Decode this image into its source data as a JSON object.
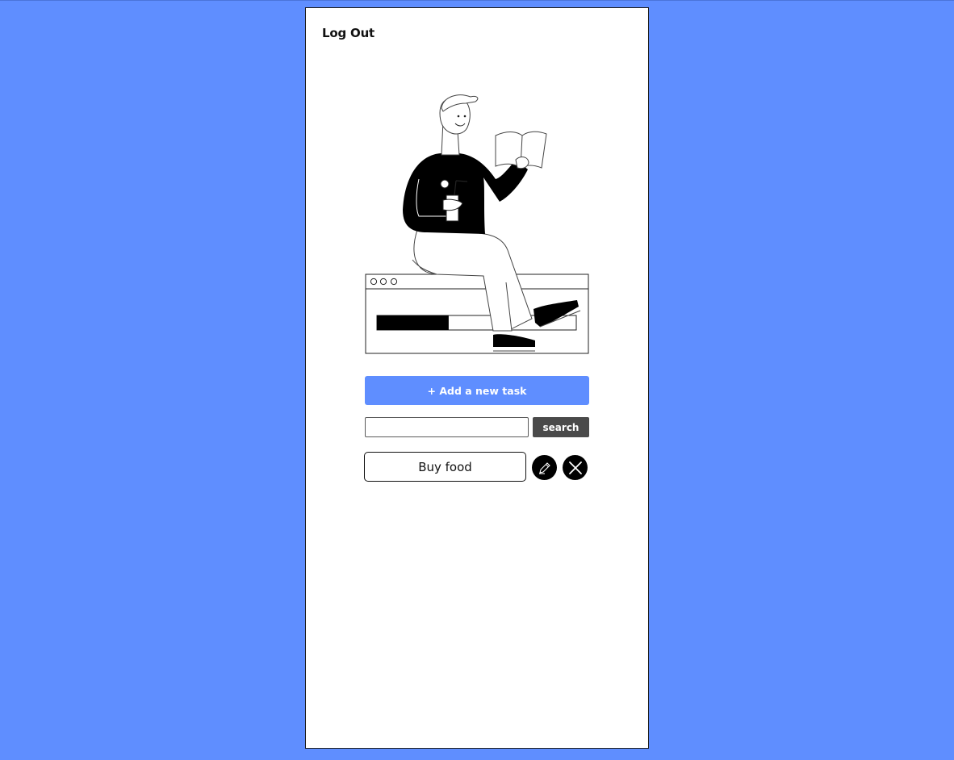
{
  "header": {
    "logout_label": "Log Out"
  },
  "actions": {
    "add_task_label": "+ Add a new task"
  },
  "search": {
    "value": "",
    "placeholder": "",
    "button_label": "search"
  },
  "tasks": [
    {
      "label": "Buy food",
      "edit_icon": "pencil-icon",
      "delete_icon": "close-icon"
    }
  ],
  "illustration": {
    "subject": "person-reading-on-browser-window",
    "progress": 0.36
  },
  "colors": {
    "background": "#5f8eff",
    "panel": "#ffffff",
    "accent": "#5f8eff",
    "search_button": "#4a4a4a",
    "icon_button": "#000000"
  }
}
